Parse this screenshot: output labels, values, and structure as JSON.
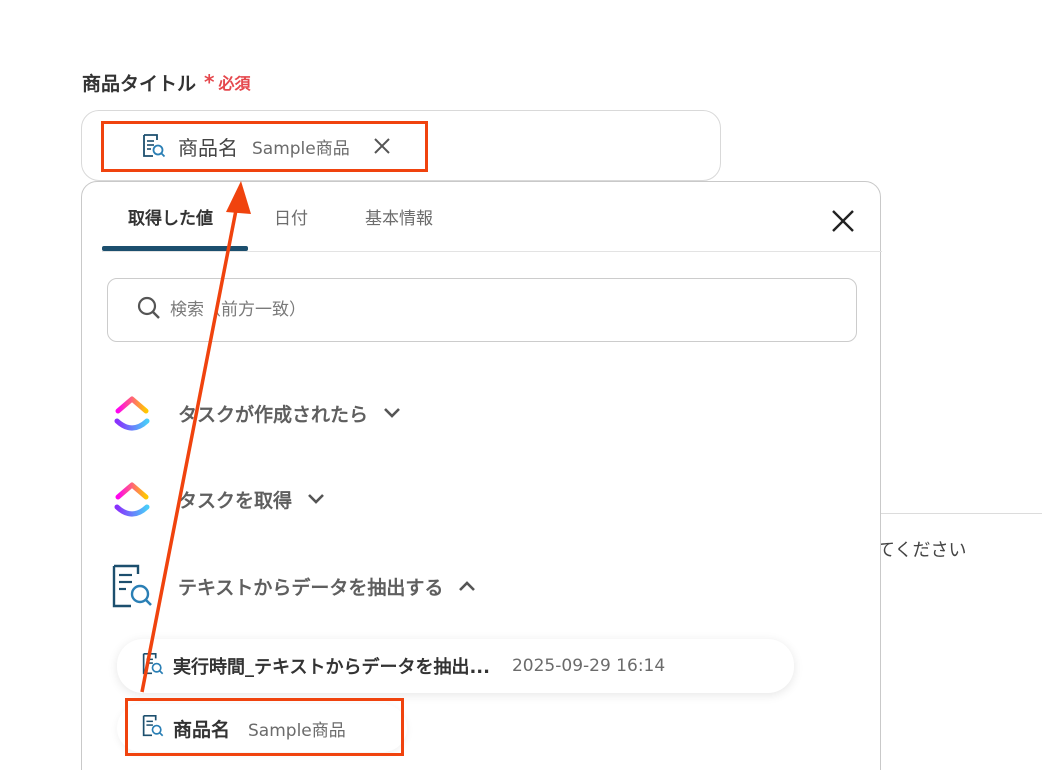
{
  "field": {
    "label": "商品タイトル",
    "required_mark": "*",
    "required_text": "必須",
    "chip": {
      "name": "商品名",
      "value": "Sample商品",
      "icon": "document-search-icon"
    }
  },
  "popup": {
    "tabs": [
      {
        "label": "取得した値",
        "active": true
      },
      {
        "label": "日付",
        "active": false
      },
      {
        "label": "基本情報",
        "active": false
      }
    ],
    "search_placeholder": "検索（前方一致）",
    "groups": [
      {
        "label": "タスクが作成されたら",
        "icon": "clickup-logo-icon",
        "expanded": false
      },
      {
        "label": "タスクを取得",
        "icon": "clickup-logo-icon",
        "expanded": false
      },
      {
        "label": "テキストからデータを抽出する",
        "icon": "document-search-icon",
        "expanded": true
      }
    ],
    "rows": [
      {
        "name": "実行時間_テキストからデータを抽出...",
        "value": "2025-09-29 16:14"
      },
      {
        "name": "商品名",
        "value": "Sample商品"
      }
    ]
  },
  "background": {
    "text": "てください"
  },
  "colors": {
    "highlight": "#f0430e",
    "required": "#e5484d",
    "tab_underline": "#1c4f6e"
  }
}
